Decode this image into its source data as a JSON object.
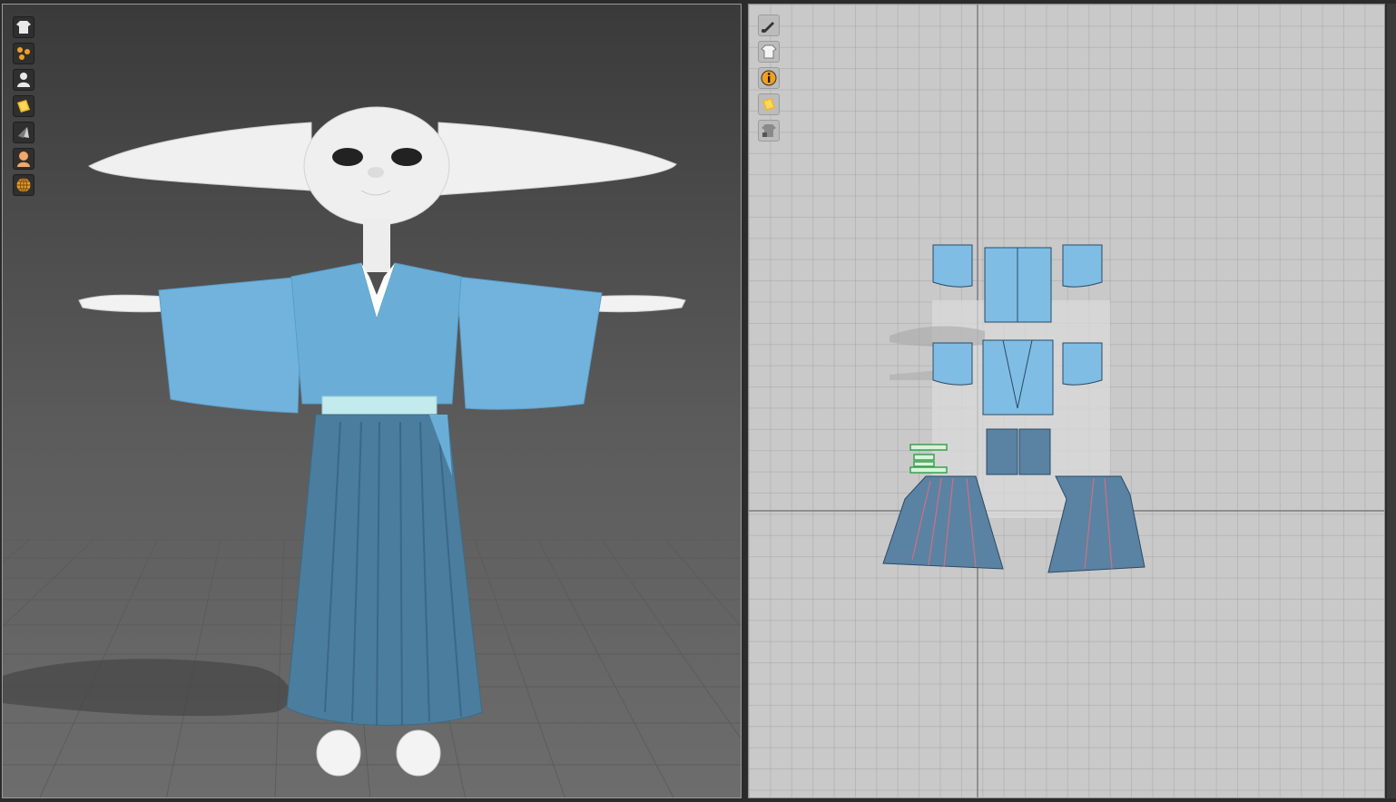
{
  "window": {
    "panes": [
      "3d-garment-viewport",
      "2d-pattern-viewport"
    ]
  },
  "toolbar_3d": {
    "icons": [
      "garment-display-icon",
      "particle-distance-icon",
      "avatar-display-icon",
      "texture-surface-icon",
      "flat-shading-icon",
      "avatar-skin-icon",
      "environment-globe-icon"
    ]
  },
  "toolbar_2d": {
    "icons": [
      "pattern-edit-icon",
      "garment-visibility-icon",
      "info-icon",
      "texture-icon",
      "garment-lock-icon"
    ]
  },
  "colors": {
    "kimono": "#6fb3dc",
    "hakama": "#4d7f9f",
    "obi": "#bfe8ea",
    "pattern_piece": "#7fbde4",
    "pattern_dark": "#5a82a3",
    "skin": "#ececec"
  }
}
